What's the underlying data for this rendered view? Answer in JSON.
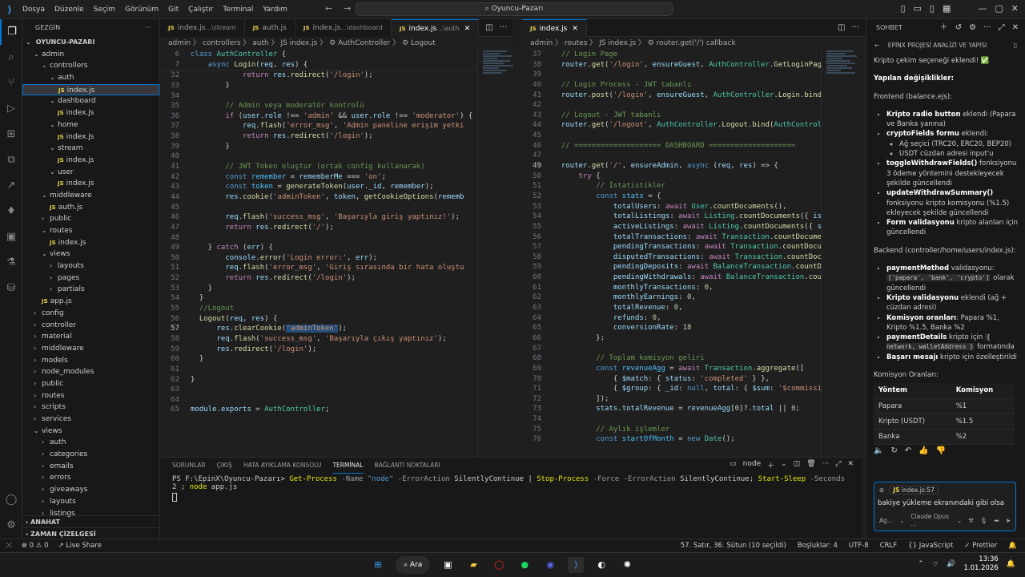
{
  "titlebar": {
    "menu": [
      "Dosya",
      "Düzenle",
      "Seçim",
      "Görünüm",
      "Git",
      "Çalıştır",
      "Terminal",
      "Yardım"
    ],
    "search": "Oyuncu-Pazarı"
  },
  "explorer": {
    "header": "GEZGİN",
    "root": "OYUNCU-PAZARI",
    "tree": [
      {
        "label": "admin",
        "depth": 1,
        "type": "folder-open"
      },
      {
        "label": "controllers",
        "depth": 2,
        "type": "folder-open"
      },
      {
        "label": "auth",
        "depth": 3,
        "type": "folder-open"
      },
      {
        "label": "index.js",
        "depth": 4,
        "type": "file",
        "selected": true
      },
      {
        "label": "dashboard",
        "depth": 3,
        "type": "folder-open"
      },
      {
        "label": "index.js",
        "depth": 4,
        "type": "file"
      },
      {
        "label": "home",
        "depth": 3,
        "type": "folder-open"
      },
      {
        "label": "index.js",
        "depth": 4,
        "type": "file"
      },
      {
        "label": "stream",
        "depth": 3,
        "type": "folder-open"
      },
      {
        "label": "index.js",
        "depth": 4,
        "type": "file"
      },
      {
        "label": "user",
        "depth": 3,
        "type": "folder-open"
      },
      {
        "label": "index.js",
        "depth": 4,
        "type": "file"
      },
      {
        "label": "middleware",
        "depth": 2,
        "type": "folder-open"
      },
      {
        "label": "auth.js",
        "depth": 3,
        "type": "file"
      },
      {
        "label": "public",
        "depth": 2,
        "type": "folder-closed"
      },
      {
        "label": "routes",
        "depth": 2,
        "type": "folder-open"
      },
      {
        "label": "index.js",
        "depth": 3,
        "type": "file"
      },
      {
        "label": "views",
        "depth": 2,
        "type": "folder-open"
      },
      {
        "label": "layouts",
        "depth": 3,
        "type": "folder-closed"
      },
      {
        "label": "pages",
        "depth": 3,
        "type": "folder-closed"
      },
      {
        "label": "partials",
        "depth": 3,
        "type": "folder-closed"
      },
      {
        "label": "app.js",
        "depth": 2,
        "type": "file"
      },
      {
        "label": "config",
        "depth": 1,
        "type": "folder-closed"
      },
      {
        "label": "controller",
        "depth": 1,
        "type": "folder-closed"
      },
      {
        "label": "material",
        "depth": 1,
        "type": "folder-closed"
      },
      {
        "label": "middleware",
        "depth": 1,
        "type": "folder-closed"
      },
      {
        "label": "models",
        "depth": 1,
        "type": "folder-closed"
      },
      {
        "label": "node_modules",
        "depth": 1,
        "type": "folder-closed"
      },
      {
        "label": "public",
        "depth": 1,
        "type": "folder-closed"
      },
      {
        "label": "routes",
        "depth": 1,
        "type": "folder-closed"
      },
      {
        "label": "scripts",
        "depth": 1,
        "type": "folder-closed"
      },
      {
        "label": "services",
        "depth": 1,
        "type": "folder-closed"
      },
      {
        "label": "views",
        "depth": 1,
        "type": "folder-open"
      },
      {
        "label": "auth",
        "depth": 2,
        "type": "folder-closed"
      },
      {
        "label": "categories",
        "depth": 2,
        "type": "folder-closed"
      },
      {
        "label": "emails",
        "depth": 2,
        "type": "folder-closed"
      },
      {
        "label": "errors",
        "depth": 2,
        "type": "folder-closed"
      },
      {
        "label": "giveaways",
        "depth": 2,
        "type": "folder-closed"
      },
      {
        "label": "layouts",
        "depth": 2,
        "type": "folder-closed"
      },
      {
        "label": "listings",
        "depth": 2,
        "type": "folder-closed"
      }
    ],
    "outline": "ANAHAT",
    "timeline": "ZAMAN ÇİZELGESİ"
  },
  "editor_left": {
    "tabs": [
      {
        "name": "index.js",
        "desc": "...\\stream",
        "active": false
      },
      {
        "name": "auth.js",
        "desc": "",
        "active": false
      },
      {
        "name": "index.js",
        "desc": "...\\dashboard",
        "active": false
      },
      {
        "name": "index.js",
        "desc": "...\\auth",
        "active": true
      }
    ],
    "breadcrumb": "admin 〉 controllers 〉 auth 〉 JS index.js 〉 ⚙ AuthController 〉 ⚙ Logout"
  },
  "editor_right": {
    "tabs": [
      {
        "name": "index.js",
        "desc": "",
        "active": true
      }
    ],
    "breadcrumb": "admin 〉 routes 〉 JS index.js 〉 ⚙ router.get('/') callback"
  },
  "panel": {
    "tabs": [
      "SORUNLAR",
      "ÇIKIŞ",
      "HATA AYIKLAMA KONSOLU",
      "TERMİNAL",
      "BAĞLANTI NOKTALARI"
    ],
    "shell": "node",
    "prompt": "PS F:\\EpinX\\Oyuncu-Pazarı>",
    "command": {
      "c1": "Get-Process",
      "p1": "-Name",
      "v1": "\"node\"",
      "p2": "-ErrorAction",
      "v2": "SilentlyContinue",
      "sep1": "|",
      "c2": "Stop-Process",
      "p3": "-Force",
      "p4": "-ErrorAction",
      "v4": "SilentlyContinue",
      "sep2": ";",
      "c3": "Start-Sleep",
      "p5": "-Seconds",
      "v5": "2",
      "sep3": ";",
      "c4": "node",
      "v6": "app.js"
    }
  },
  "chat": {
    "header": "SOHBET",
    "title": "EPİNX PROJESİ ANALİZİ VE YAPISI",
    "intro": "Kripto çekim seçeneği eklendi! ✅",
    "changes_title": "Yapılan değişiklikler:",
    "frontend_title": "Frontend (balance.ejs):",
    "frontend": [
      {
        "b": "Kripto radio button",
        "t": " eklendi (Papara ve Banka yanına)"
      },
      {
        "b": "cryptoFields formu",
        "t": " eklendi:",
        "sub": [
          "Ağ seçici (TRC20, ERC20, BEP20)",
          "USDT cüzdan adresi input'u"
        ]
      },
      {
        "b": "toggleWithdrawFields()",
        "t": " fonksiyonu 3 ödeme yöntemini destekleyecek şekilde güncellendi"
      },
      {
        "b": "updateWithdrawSummary()",
        "t": " fonksiyonu kripto komisyonu (%1.5) ekleyecek şekilde güncellendi"
      },
      {
        "b": "Form validasyonu",
        "t": " kripto alanları için güncellendi"
      }
    ],
    "backend_title": "Backend (controller/home/users/index.js):",
    "backend": {
      "payment_b": "paymentMethod",
      "payment_t": " validasyonu:",
      "payment_code": "['papara', 'bank', 'crypto']",
      "payment_t2": " olarak güncellendi",
      "crypto_b": "Kripto validasyonu",
      "crypto_t": " eklendi (ağ + cüzdan adresi)",
      "comm_b": "Komisyon oranları",
      "comm_t": ": Papara %1, Kripto %1.5, Banka %2",
      "details_b": "paymentDetails",
      "details_t": " kripto için ",
      "details_code": "{ network, walletAddress }",
      "details_t2": " formatında",
      "success_b": "Başarı mesajı",
      "success_t": " kripto için özelleştirildi"
    },
    "rates_title": "Komisyon Oranları:",
    "table": {
      "headers": [
        "Yöntem",
        "Komisyon"
      ],
      "rows": [
        [
          "Papara",
          "%1"
        ],
        [
          "Kripto (USDT)",
          "%1.5"
        ],
        [
          "Banka",
          "%2"
        ]
      ]
    },
    "input": {
      "attachment": "index.js:57",
      "text": "bakiye yükleme ekranındaki gibi olsa",
      "agent": "Ag...",
      "model": "Claude Opus ..."
    }
  },
  "statusbar": {
    "errors": "0",
    "warnings": "0",
    "live": "Live Share",
    "position": "57. Satır, 36. Sütun (10 seçildi)",
    "spaces": "Boşluklar: 4",
    "encoding": "UTF-8",
    "eol": "CRLF",
    "language": "JavaScript",
    "prettier": "Prettier"
  },
  "taskbar": {
    "search": "Ara",
    "time": "13:36",
    "date": "1.01.2026"
  }
}
